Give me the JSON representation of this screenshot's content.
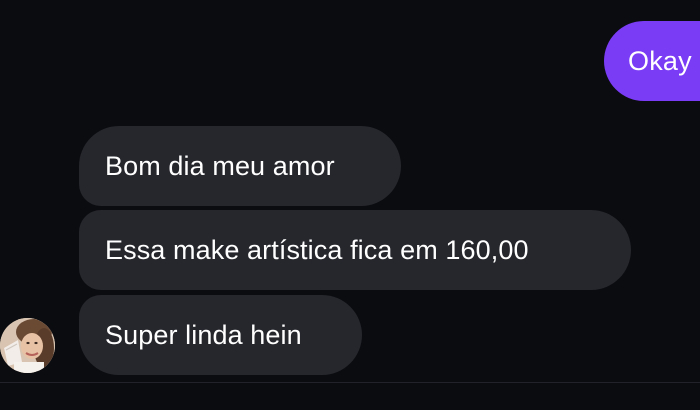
{
  "messages": {
    "outgoing": [
      {
        "text": "Okay"
      }
    ],
    "incoming": [
      {
        "text": "Bom dia meu amor"
      },
      {
        "text": "Essa make artística fica em 160,00"
      },
      {
        "text": "Super linda hein"
      }
    ]
  },
  "avatar": {
    "icon": "contact-avatar"
  },
  "colors": {
    "background": "#0b0c10",
    "incoming_bubble": "#26272d",
    "outgoing_bubble": "#7a3cf5",
    "text": "#ffffff"
  }
}
